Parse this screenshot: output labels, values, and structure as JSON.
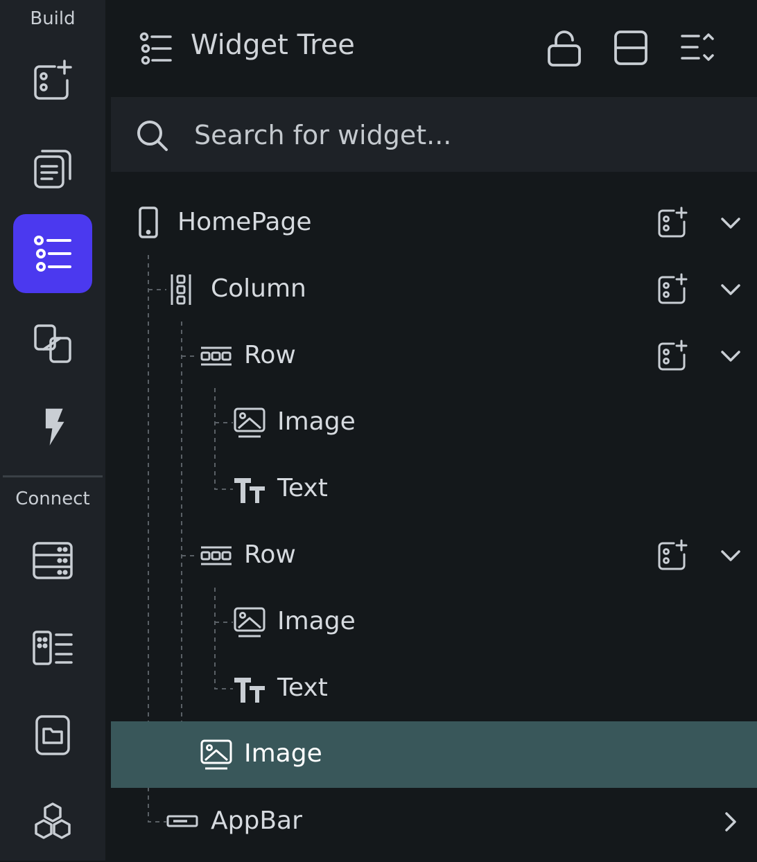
{
  "rail": {
    "build_label": "Build",
    "connect_label": "Connect",
    "build_items": [
      {
        "icon": "add-widget-icon"
      },
      {
        "icon": "page-stack-icon"
      },
      {
        "icon": "widget-tree-icon",
        "active": true
      },
      {
        "icon": "component-link-icon"
      },
      {
        "icon": "lightning-icon"
      }
    ],
    "connect_items": [
      {
        "icon": "database-icon"
      },
      {
        "icon": "api-list-icon"
      },
      {
        "icon": "folder-icon"
      },
      {
        "icon": "integrations-icon"
      }
    ]
  },
  "header": {
    "title": "Widget Tree",
    "icons": [
      "unlock-icon",
      "split-view-icon",
      "collapse-expand-icon"
    ]
  },
  "search": {
    "placeholder": "Search for widget..."
  },
  "tree": {
    "nodes": [
      {
        "label": "HomePage",
        "icon": "phone-icon",
        "depth": 0,
        "has_add": true,
        "chevron": "down"
      },
      {
        "label": "Column",
        "icon": "column-icon",
        "depth": 1,
        "has_add": true,
        "chevron": "down"
      },
      {
        "label": "Row",
        "icon": "row-icon",
        "depth": 2,
        "has_add": true,
        "chevron": "down"
      },
      {
        "label": "Image",
        "icon": "image-icon",
        "depth": 3
      },
      {
        "label": "Text",
        "icon": "text-icon",
        "depth": 3
      },
      {
        "label": "Row",
        "icon": "row-icon",
        "depth": 2,
        "has_add": true,
        "chevron": "down"
      },
      {
        "label": "Image",
        "icon": "image-icon",
        "depth": 3
      },
      {
        "label": "Text",
        "icon": "text-icon",
        "depth": 3
      },
      {
        "label": "Image",
        "icon": "image-icon",
        "depth": 2,
        "selected": true
      },
      {
        "label": "AppBar",
        "icon": "appbar-icon",
        "depth": 1,
        "chevron": "right"
      }
    ]
  },
  "colors": {
    "accent": "#4b39ef",
    "selected_row": "#39575a",
    "rail_bg": "#1e2227",
    "panel_bg": "#14181b"
  }
}
